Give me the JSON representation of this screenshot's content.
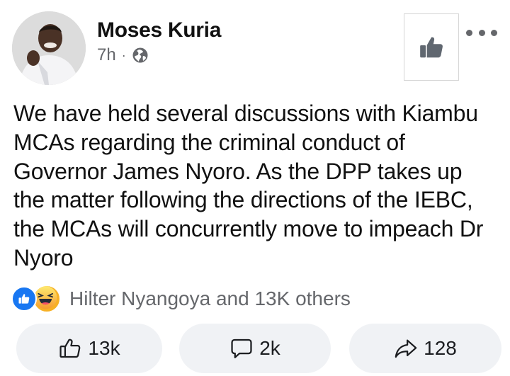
{
  "post": {
    "author": "Moses Kuria",
    "time": "7h",
    "separator": "·",
    "text": "We have held several discussions with Kiambu MCAs regarding the criminal conduct of Governor James Nyoro. As the DPP takes up the matter following the directions of the IEBC, the MCAs will concurrently move to impeach Dr Nyoro"
  },
  "reactions": {
    "summary": "Hilter Nyangoya and 13K others",
    "icons": [
      "like-reaction-icon",
      "haha-reaction-icon"
    ]
  },
  "actions": {
    "like_count": "13k",
    "comment_count": "2k",
    "share_count": "128"
  },
  "colors": {
    "accent": "#1877f2",
    "muted": "#65676b",
    "button_bg": "#f0f2f5"
  }
}
